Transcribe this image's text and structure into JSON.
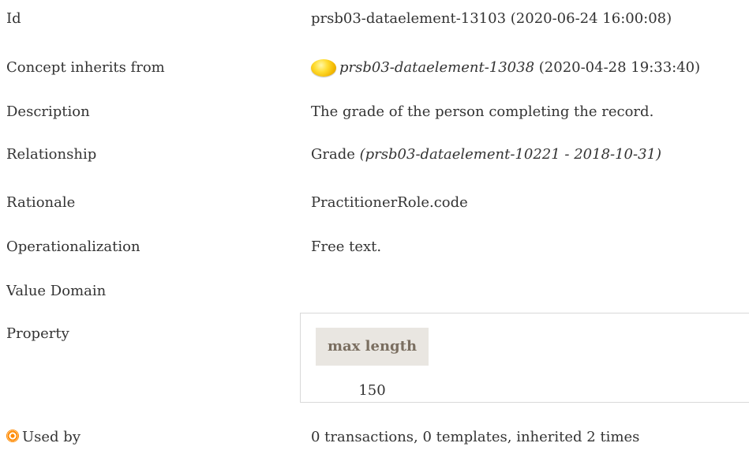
{
  "rows": {
    "id": {
      "label": "Id",
      "value": "prsb03-dataelement-13103 (2020-06-24 16:00:08)"
    },
    "inherits": {
      "label": "Concept inherits from",
      "ref": "prsb03-dataelement-13038",
      "date": " (2020-04-28 19:33:40)",
      "icon": "yellow-status-dot-icon"
    },
    "description": {
      "label": "Description",
      "value": "The grade of the person completing the record."
    },
    "relationship": {
      "label": "Relationship",
      "value": "Grade ",
      "ref": "(prsb03-dataelement-10221 - 2018-10-31)"
    },
    "rationale": {
      "label": "Rationale",
      "value": "PractitionerRole.code"
    },
    "operationalization": {
      "label": "Operationalization",
      "value": "Free text."
    },
    "value_domain": {
      "label": "Value Domain"
    },
    "property": {
      "label": "Property",
      "header": "max length",
      "value": "150"
    },
    "used_by": {
      "label": "Used by",
      "icon": "target-icon",
      "value": "0 transactions, 0 templates, inherited 2 times"
    }
  }
}
